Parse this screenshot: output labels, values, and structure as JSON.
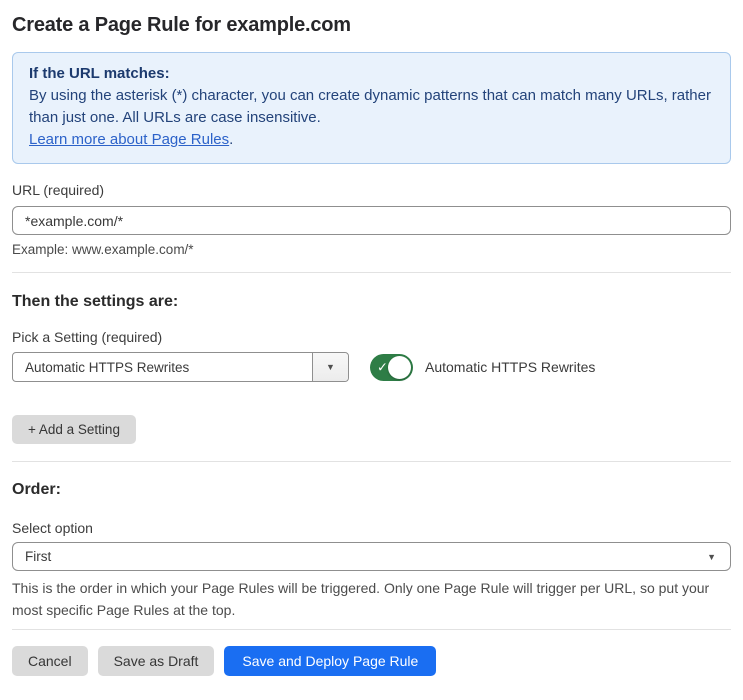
{
  "page": {
    "title": "Create a Page Rule for example.com"
  },
  "info_box": {
    "heading": "If the URL matches:",
    "body": "By using the asterisk (*) character, you can create dynamic patterns that can match many URLs, rather than just one. All URLs are case insensitive.",
    "link_text": "Learn more about Page Rules",
    "link_suffix": "."
  },
  "url_field": {
    "label": "URL (required)",
    "value": "*example.com/*",
    "example": "Example: www.example.com/*"
  },
  "settings_section": {
    "heading": "Then the settings are:",
    "pick_label": "Pick a Setting (required)",
    "selected_setting": "Automatic HTTPS Rewrites",
    "toggle_state": "on",
    "toggle_label": "Automatic HTTPS Rewrites",
    "add_button_label": "+ Add a Setting"
  },
  "order_section": {
    "heading": "Order:",
    "select_label": "Select option",
    "selected_option": "First",
    "help": "This is the order in which your Page Rules will be triggered. Only one Page Rule will trigger per URL, so put your most specific Page Rules at the top."
  },
  "footer": {
    "cancel_label": "Cancel",
    "save_draft_label": "Save as Draft",
    "save_deploy_label": "Save and Deploy Page Rule"
  },
  "icons": {
    "dropdown_arrow": "▼",
    "toggle_check": "✓"
  },
  "colors": {
    "info_bg": "#e9f2fc",
    "info_border": "#a9c9ec",
    "info_text": "#23437a",
    "link_blue": "#2c62c9",
    "toggle_green": "#2e7d46",
    "primary_button_blue": "#1a6ef2",
    "secondary_button_gray": "#dadada",
    "divider_gray": "#e2e2e2"
  }
}
